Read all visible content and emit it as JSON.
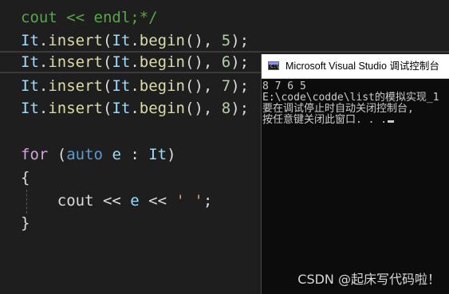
{
  "editor": {
    "lines": [
      {
        "parts": [
          {
            "cls": "cmt",
            "text": "cout << endl;*/"
          }
        ]
      },
      {
        "parts": [
          {
            "cls": "id",
            "text": "It"
          },
          {
            "cls": "pl",
            "text": "."
          },
          {
            "cls": "fn",
            "text": "insert"
          },
          {
            "cls": "pl",
            "text": "("
          },
          {
            "cls": "id",
            "text": "It"
          },
          {
            "cls": "pl",
            "text": "."
          },
          {
            "cls": "fn",
            "text": "begin"
          },
          {
            "cls": "pl",
            "text": "(), "
          },
          {
            "cls": "num",
            "text": "5"
          },
          {
            "cls": "pl",
            "text": ");"
          }
        ]
      },
      {
        "parts": [
          {
            "cls": "id",
            "text": "It"
          },
          {
            "cls": "pl",
            "text": "."
          },
          {
            "cls": "fn",
            "text": "insert"
          },
          {
            "cls": "pl",
            "text": "("
          },
          {
            "cls": "id",
            "text": "It"
          },
          {
            "cls": "pl",
            "text": "."
          },
          {
            "cls": "fn",
            "text": "begin"
          },
          {
            "cls": "pl",
            "text": "(), "
          },
          {
            "cls": "num",
            "text": "6"
          },
          {
            "cls": "pl",
            "text": ");"
          }
        ]
      },
      {
        "parts": [
          {
            "cls": "id",
            "text": "It"
          },
          {
            "cls": "pl",
            "text": "."
          },
          {
            "cls": "fn",
            "text": "insert"
          },
          {
            "cls": "pl",
            "text": "("
          },
          {
            "cls": "id",
            "text": "It"
          },
          {
            "cls": "pl",
            "text": "."
          },
          {
            "cls": "fn",
            "text": "begin"
          },
          {
            "cls": "pl",
            "text": "(), "
          },
          {
            "cls": "num",
            "text": "7"
          },
          {
            "cls": "pl",
            "text": ");"
          }
        ]
      },
      {
        "parts": [
          {
            "cls": "id",
            "text": "It"
          },
          {
            "cls": "pl",
            "text": "."
          },
          {
            "cls": "fn",
            "text": "insert"
          },
          {
            "cls": "pl",
            "text": "("
          },
          {
            "cls": "id",
            "text": "It"
          },
          {
            "cls": "pl",
            "text": "."
          },
          {
            "cls": "fn",
            "text": "begin"
          },
          {
            "cls": "pl",
            "text": "(), "
          },
          {
            "cls": "num",
            "text": "8"
          },
          {
            "cls": "pl",
            "text": ");"
          }
        ]
      },
      {
        "parts": []
      },
      {
        "parts": [
          {
            "cls": "ctl",
            "text": "for"
          },
          {
            "cls": "pl",
            "text": " ("
          },
          {
            "cls": "kw",
            "text": "auto"
          },
          {
            "cls": "pl",
            "text": " "
          },
          {
            "cls": "id",
            "text": "e"
          },
          {
            "cls": "pl",
            "text": " : "
          },
          {
            "cls": "id",
            "text": "It"
          },
          {
            "cls": "pl",
            "text": ")"
          }
        ]
      },
      {
        "parts": [
          {
            "cls": "pl",
            "text": "{"
          }
        ]
      },
      {
        "parts": [
          {
            "cls": "pl",
            "text": "    cout << "
          },
          {
            "cls": "id",
            "text": "e"
          },
          {
            "cls": "pl",
            "text": " << "
          },
          {
            "cls": "str",
            "text": "' '"
          },
          {
            "cls": "pl",
            "text": ";"
          }
        ]
      },
      {
        "parts": [
          {
            "cls": "pl",
            "text": "}"
          }
        ]
      }
    ],
    "current_line_index": 2
  },
  "console": {
    "title": "Microsoft Visual Studio 调试控制台",
    "icon": "console-app-icon",
    "icon_glyph": "C:\\",
    "output": [
      "8 7 6 5",
      "E:\\code\\codde\\list的模拟实现_1",
      "要在调试停止时自动关闭控制台,",
      "按任意键关闭此窗口. . ."
    ]
  },
  "watermark": "CSDN @起床写代码啦！",
  "colors": {
    "editor_bg": "#1e1e1e",
    "comment": "#57a64a",
    "keyword": "#569cd6",
    "control": "#d8a0df",
    "identifier": "#9cdcfe",
    "function": "#dcdcaa",
    "number": "#b5cea8",
    "string": "#d69d85",
    "console_bg": "#0c0c0c",
    "console_text": "#cccccc"
  }
}
